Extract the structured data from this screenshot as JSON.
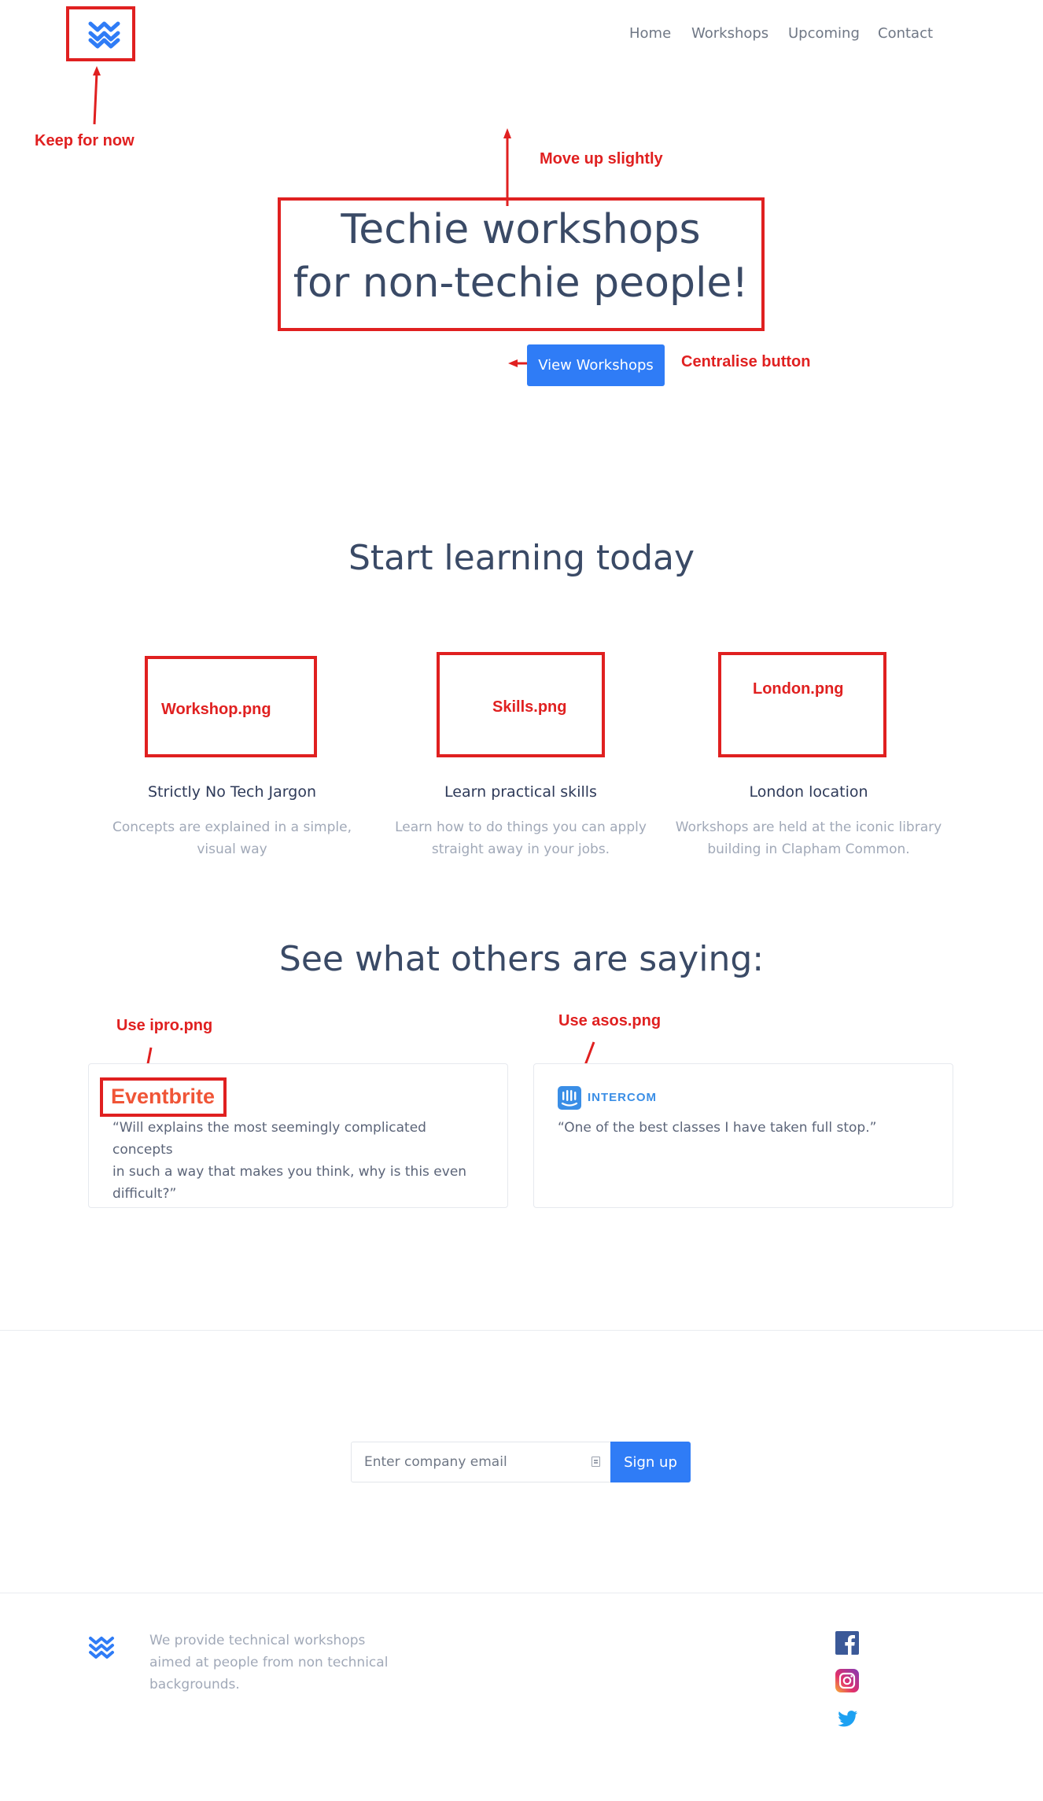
{
  "nav": {
    "items": [
      "Home",
      "Workshops",
      "Upcoming",
      "Contact"
    ]
  },
  "hero": {
    "title_line1": "Techie workshops",
    "title_line2": "for non-techie people!",
    "button_label": "View Workshops"
  },
  "annotations": {
    "keep_for_now": "Keep for now",
    "move_up": "Move up slightly",
    "centralise": "Centralise button",
    "workshop_png": "Workshop.png",
    "skills_png": "Skills.png",
    "london_png": "London.png",
    "use_ipro": "Use ipro.png",
    "use_asos": "Use asos.png"
  },
  "features": {
    "title": "Start learning today",
    "items": [
      {
        "title": "Strictly No Tech Jargon",
        "desc_line1": "Concepts are explained in a simple,",
        "desc_line2": "visual way"
      },
      {
        "title": "Learn practical skills",
        "desc_line1": "Learn how to do things you can apply",
        "desc_line2": "straight away in your jobs."
      },
      {
        "title": "London location",
        "desc_line1": "Workshops are held at the iconic library",
        "desc_line2": "building in Clapham Common."
      }
    ]
  },
  "testimonials": {
    "title": "See what others are saying:",
    "items": [
      {
        "logo": "Eventbrite",
        "quote_line1": "“Will explains the most seemingly complicated concepts",
        "quote_line2": "in such a way that makes you think, why is this even",
        "quote_line3": "difficult?”"
      },
      {
        "logo": "INTERCOM",
        "quote_line1": "“One of the best classes I have taken full stop.”"
      }
    ]
  },
  "signup": {
    "placeholder": "Enter company email",
    "button_label": "Sign up"
  },
  "footer": {
    "line1": "We provide technical workshops",
    "line2": "aimed at people from non technical",
    "line3": "backgrounds.",
    "social_icons": [
      "facebook-icon",
      "instagram-icon",
      "twitter-icon"
    ]
  },
  "colors": {
    "accent": "#2f7cf6",
    "annotation": "#e02020",
    "eventbrite": "#f05537",
    "intercom": "#3a8ee6"
  }
}
